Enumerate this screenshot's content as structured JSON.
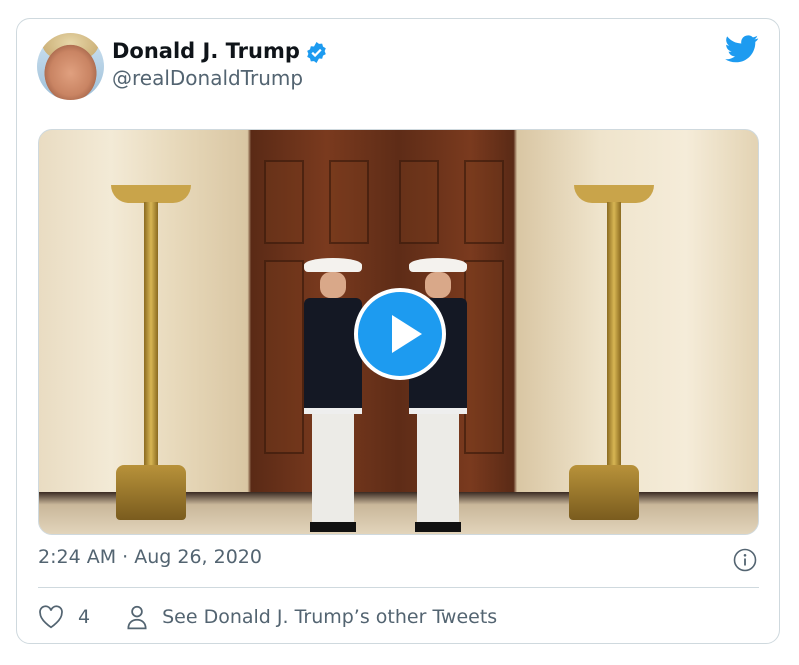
{
  "author": {
    "name": "Donald J. Trump",
    "handle": "@realDonaldTrump",
    "verified": true
  },
  "tweet": {
    "timestamp": "2:24 AM · Aug 26, 2020",
    "likes": "4"
  },
  "actions": {
    "see_more": "See Donald J. Trump’s other Tweets"
  },
  "colors": {
    "accent": "#1d9bf0",
    "secondary_text": "#536471",
    "border": "#cfd9de"
  },
  "icons": [
    "twitter-bird-icon",
    "verified-badge-icon",
    "play-icon",
    "info-icon",
    "heart-icon",
    "person-icon"
  ]
}
